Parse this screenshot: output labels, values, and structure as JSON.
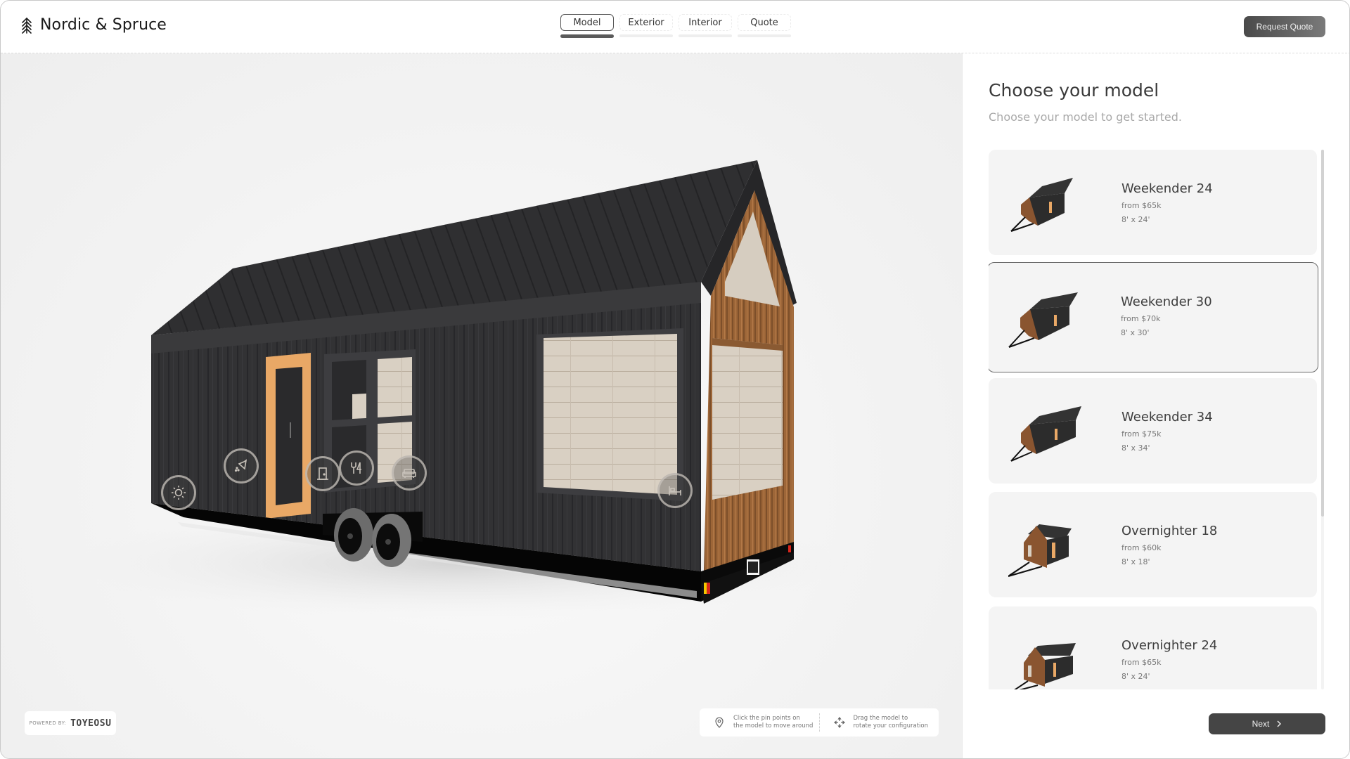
{
  "header": {
    "brand": "Nordic & Spruce",
    "brand_icon": "spruce-tree-icon",
    "tabs": [
      {
        "label": "Model",
        "active": true
      },
      {
        "label": "Exterior",
        "active": false
      },
      {
        "label": "Interior",
        "active": false
      },
      {
        "label": "Quote",
        "active": false
      }
    ],
    "request_quote_label": "Request Quote"
  },
  "viewer": {
    "pins": [
      {
        "icon": "sun-icon",
        "label": "Exterior lighting"
      },
      {
        "icon": "shower-icon",
        "label": "Bathroom"
      },
      {
        "icon": "door-icon",
        "label": "Entry door"
      },
      {
        "icon": "fork-knife-icon",
        "label": "Kitchen"
      },
      {
        "icon": "sofa-icon",
        "label": "Living"
      },
      {
        "icon": "bed-icon",
        "label": "Bedroom"
      }
    ],
    "powered_by_label": "POWERED BY:",
    "powered_by_brand": "TOYEOSU",
    "hints": [
      {
        "icon": "map-pin-icon",
        "line1": "Click the pin points on",
        "line2": "the model to move around"
      },
      {
        "icon": "move-arrows-icon",
        "line1": "Drag the model to",
        "line2": "rotate your configuration"
      }
    ],
    "colors": {
      "siding": "#2f2f31",
      "roof": "#2b2b2d",
      "cedar": "#a0683c",
      "door_frame": "#e8a868",
      "interior_wood": "#d8cfc2"
    }
  },
  "panel": {
    "title": "Choose your model",
    "subtitle": "Choose your model to get started.",
    "models": [
      {
        "name": "Weekender 24",
        "price": "from $65k",
        "size": "8' x 24'",
        "selected": false
      },
      {
        "name": "Weekender 30",
        "price": "from $70k",
        "size": "8' x 30'",
        "selected": true
      },
      {
        "name": "Weekender 34",
        "price": "from $75k",
        "size": "8' x 34'",
        "selected": false
      },
      {
        "name": "Overnighter 18",
        "price": "from $60k",
        "size": "8' x 18'",
        "selected": false
      },
      {
        "name": "Overnighter 24",
        "price": "from $65k",
        "size": "8' x 24'",
        "selected": false
      }
    ],
    "next_label": "Next"
  }
}
